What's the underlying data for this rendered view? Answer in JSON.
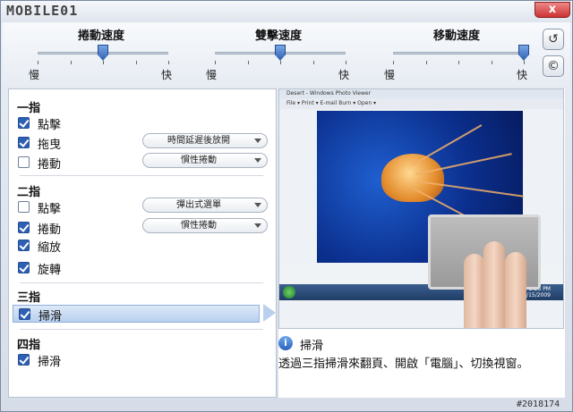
{
  "window": {
    "logo": "MOBILE01",
    "close_glyph": "x"
  },
  "sliders": [
    {
      "title": "捲動速度",
      "slow": "慢",
      "fast": "快",
      "level": 0.5
    },
    {
      "title": "雙擊速度",
      "slow": "慢",
      "fast": "快",
      "level": 0.5
    },
    {
      "title": "移動速度",
      "slow": "慢",
      "fast": "快",
      "level": 1.0
    }
  ],
  "side_buttons": [
    {
      "name": "reset-icon",
      "glyph": "↺"
    },
    {
      "name": "copyright-icon",
      "glyph": "©"
    }
  ],
  "sections": {
    "one": {
      "title": "一指",
      "tap": "點擊",
      "drag": "拖曳",
      "drag_option": "時間延遲後放開",
      "scroll": "捲動",
      "scroll_option": "慣性捲動"
    },
    "two": {
      "title": "二指",
      "tap": "點擊",
      "tap_option": "彈出式選單",
      "scroll": "捲動",
      "scroll_option": "慣性捲動",
      "zoom": "縮放",
      "rotate": "旋轉"
    },
    "three": {
      "title": "三指",
      "swipe": "掃滑"
    },
    "four": {
      "title": "四指",
      "swipe": "掃滑"
    }
  },
  "checkbox_states": {
    "one_tap": true,
    "one_drag": true,
    "one_scroll": false,
    "two_tap": false,
    "two_scroll": true,
    "two_zoom": true,
    "two_rotate": true,
    "three_swipe": true,
    "four_swipe": true
  },
  "preview": {
    "title": "Desert - Windows Photo Viewer",
    "menu": "File ▾   Print ▾   E-mail   Burn ▾   Open ▾",
    "time": "2:25 PM",
    "date": "1/15/2009"
  },
  "info": {
    "icon": "i",
    "title": "掃滑",
    "description": "透過三指掃滑來翻頁、開啟「電腦」、切換視窗。"
  },
  "watermark": "#2018174",
  "colors": {
    "accent": "#2d5fb4",
    "selection": "#b9d0ee"
  }
}
